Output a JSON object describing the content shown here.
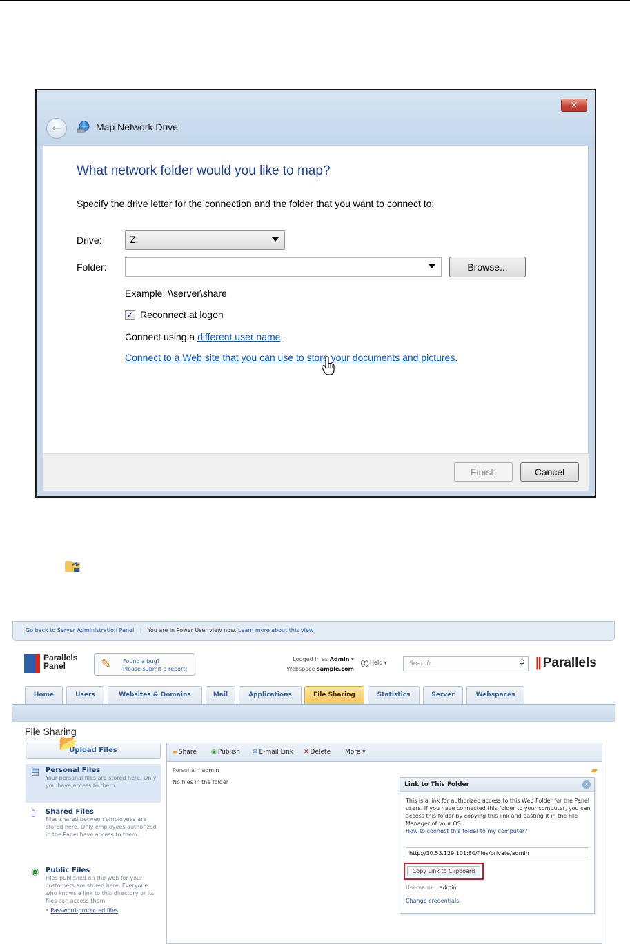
{
  "dialog": {
    "title": "Map Network Drive",
    "close_glyph": "✕",
    "back_glyph": "←",
    "heading": "What network folder would you like to map?",
    "instruction": "Specify the drive letter for the connection and the folder that you want to connect to:",
    "drive_label": "Drive:",
    "drive_value": "Z:",
    "folder_label": "Folder:",
    "folder_value": "",
    "browse_label": "Browse...",
    "example": "Example: \\\\server\\share",
    "reconnect_label": "Reconnect at logon",
    "reconnect_checked": true,
    "connect_prefix": "Connect using a ",
    "connect_link": "different user name",
    "connect_suffix": ".",
    "web_link": "Connect to a Web site that you can use to store your documents and pictures",
    "web_suffix": ".",
    "finish_label": "Finish",
    "cancel_label": "Cancel",
    "cursor_icon": "hand-pointer-icon"
  },
  "panel": {
    "topbar": {
      "back_link": "Go back to Server Administration Panel",
      "view_text": "You are in Power User view now.",
      "learn_link": "Learn more about this view"
    },
    "logo_line1": "Parallels",
    "logo_line2": "Panel",
    "bug_line1": "Found a bug?",
    "bug_line2": "Please submit a report!",
    "logged_prefix": "Logged in as",
    "logged_user": "Admin",
    "webspace_prefix": "Webspace",
    "webspace_value": "sample.com",
    "help_label": "Help",
    "search_placeholder": "Search...",
    "brand": "Parallels",
    "tabs": [
      "Home",
      "Users",
      "Websites & Domains",
      "Mail",
      "Applications",
      "File Sharing",
      "Statistics",
      "Server",
      "Webspaces"
    ],
    "active_tab": "File Sharing",
    "page_title": "File Sharing",
    "upload_label": "Upload Files",
    "sidebar": [
      {
        "title": "Personal Files",
        "desc": "Your personal files are stored here. Only you have access to them."
      },
      {
        "title": "Shared Files",
        "desc": "Files shared between employees are stored here. Only employees authorized in the Panel have access to them."
      },
      {
        "title": "Public Files",
        "desc": "Files published on the web for your customers are stored here. Everyone who knows a link to this directory or its files can access them."
      }
    ],
    "protected_link": "Password-protected files",
    "toolbar": {
      "share": "Share",
      "publish": "Publish",
      "email": "E-mail Link",
      "delete": "Delete",
      "more": "More"
    },
    "crumb_root": "Personal",
    "crumb_current": "admin",
    "no_files": "No files in the folder",
    "popup": {
      "title": "Link to This Folder",
      "desc": "This is a link for authorized access to this Web Folder for the Panel users. If you have connected this folder to your computer, you can access this folder by copying this link and pasting it in the File Manager of your OS.",
      "howto": "How to connect this folder to my computer?",
      "url": "http://10.53.129.101:80/files/private/admin",
      "copy_label": "Copy Link to Clipboard",
      "username_label": "Username:",
      "username_value": "admin",
      "change_link": "Change credentials"
    }
  },
  "colors": {
    "dialog_heading": "#1e3f8a",
    "link": "#0b55c4",
    "active_tab": "#f6c55a",
    "highlight_border": "#c71c2c",
    "brand_red": "#d9261c"
  }
}
